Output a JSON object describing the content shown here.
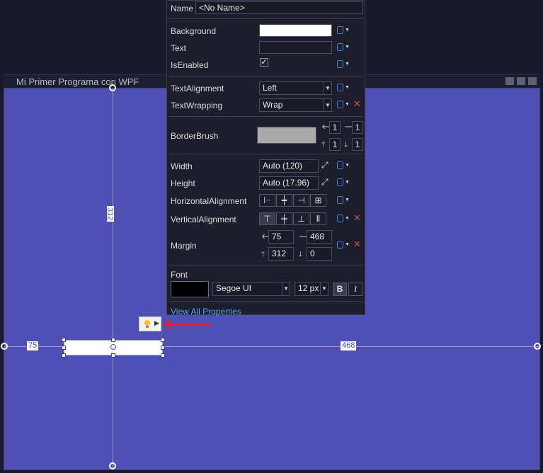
{
  "window": {
    "title": "Mi Primer Programa con WPF"
  },
  "designer": {
    "dim_top": "312",
    "dim_left": "75",
    "dim_right": "468",
    "colors": {
      "canvas": "#5050b4",
      "guide": "#9898d4",
      "arrow": "#e02030"
    }
  },
  "properties": {
    "name_label": "Name",
    "name_value": "<No Name>",
    "background_label": "Background",
    "text_label": "Text",
    "isenabled_label": "IsEnabled",
    "isenabled_checked": true,
    "textalignment_label": "TextAlignment",
    "textalignment_value": "Left",
    "textwrapping_label": "TextWrapping",
    "textwrapping_value": "Wrap",
    "borderbrush_label": "BorderBrush",
    "border_thickness": {
      "left": "1",
      "right": "1",
      "top": "1",
      "bottom": "1"
    },
    "width_label": "Width",
    "width_value": "Auto (120)",
    "height_label": "Height",
    "height_value": "Auto (17.96)",
    "halign_label": "HorizontalAlignment",
    "valign_label": "VerticalAlignment",
    "margin_label": "Margin",
    "margin": {
      "left": "75",
      "right": "468",
      "top": "312",
      "bottom": "0"
    },
    "font_label": "Font",
    "font_family": "Segoe UI",
    "font_size": "12 px",
    "bold_label": "B",
    "italic_label": "I",
    "view_all": "View All Properties",
    "colors": {
      "background_swatch": "#ffffff",
      "borderbrush_swatch": "#aaaaaa",
      "font_swatch": "#000000",
      "link": "#4da3ff"
    }
  }
}
